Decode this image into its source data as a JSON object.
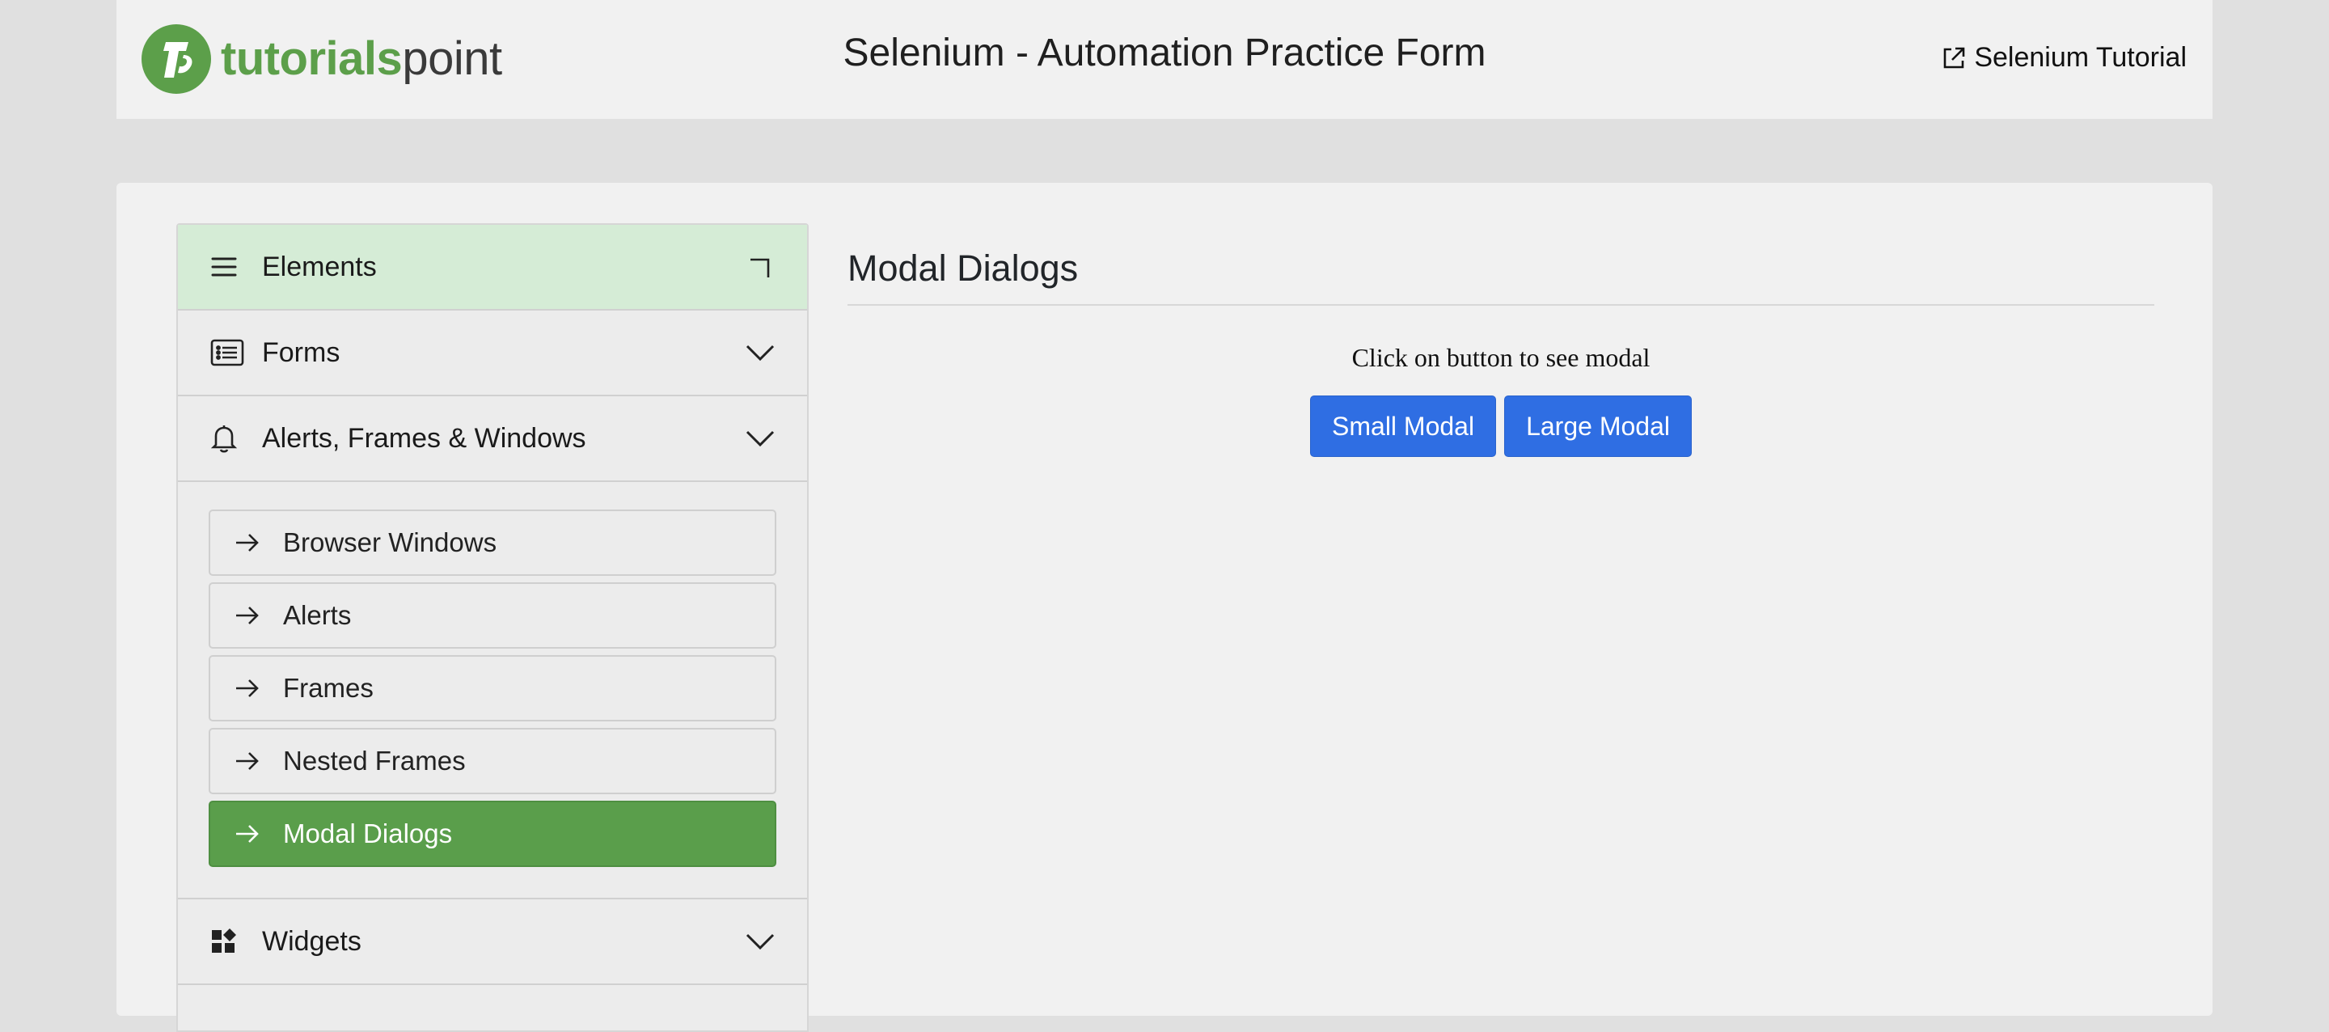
{
  "header": {
    "logo_bold": "tutorials",
    "logo_light": "point",
    "title": "Selenium - Automation Practice Form",
    "link_label": "Selenium Tutorial",
    "link_icon": "external-link-icon"
  },
  "sidebar": {
    "sections": [
      {
        "label": "Elements",
        "icon": "menu-icon",
        "state": "active",
        "toggle_icon": "corner-icon"
      },
      {
        "label": "Forms",
        "icon": "list-icon",
        "state": "collapsed",
        "toggle_icon": "chevron-down-icon"
      },
      {
        "label": "Alerts, Frames & Windows",
        "icon": "bell-icon",
        "state": "expanded",
        "toggle_icon": "chevron-down-icon"
      },
      {
        "label": "Widgets",
        "icon": "widgets-icon",
        "state": "collapsed",
        "toggle_icon": "chevron-down-icon"
      }
    ],
    "alerts_items": [
      {
        "label": "Browser Windows",
        "selected": false
      },
      {
        "label": "Alerts",
        "selected": false
      },
      {
        "label": "Frames",
        "selected": false
      },
      {
        "label": "Nested Frames",
        "selected": false
      },
      {
        "label": "Modal Dialogs",
        "selected": true
      }
    ]
  },
  "main": {
    "title": "Modal Dialogs",
    "instruction": "Click on button to see modal",
    "buttons": {
      "small": "Small Modal",
      "large": "Large Modal"
    }
  },
  "colors": {
    "brand_green": "#5c9f4a",
    "active_section_bg": "#d5ecd6",
    "selected_item_bg": "#5a9e4b",
    "primary_button": "#2f6ee3"
  }
}
